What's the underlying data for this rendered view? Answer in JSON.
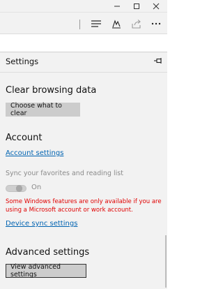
{
  "panel": {
    "title": "Settings",
    "clear_browsing": {
      "title": "Clear browsing data",
      "button_label": "Choose what to clear"
    },
    "account": {
      "title": "Account",
      "settings_link": "Account settings",
      "sync_label": "Sync your favorites and reading list",
      "sync_toggle_state": "On",
      "warning": "Some Windows features are only available if you are using a Microsoft account or work account.",
      "device_sync_link": "Device sync settings"
    },
    "advanced": {
      "title": "Advanced settings",
      "button_label": "View advanced settings"
    }
  },
  "icons": {
    "minimize": "minimize-icon",
    "maximize": "maximize-icon",
    "close": "close-icon",
    "hub": "hub-icon",
    "web_note": "web-note-icon",
    "share": "share-icon",
    "more": "more-icon",
    "pin": "pin-icon"
  },
  "colors": {
    "link": "#0063b1",
    "warning": "#e00000",
    "panel_bg": "#f2f2f2",
    "button_bg": "#cccccc"
  }
}
